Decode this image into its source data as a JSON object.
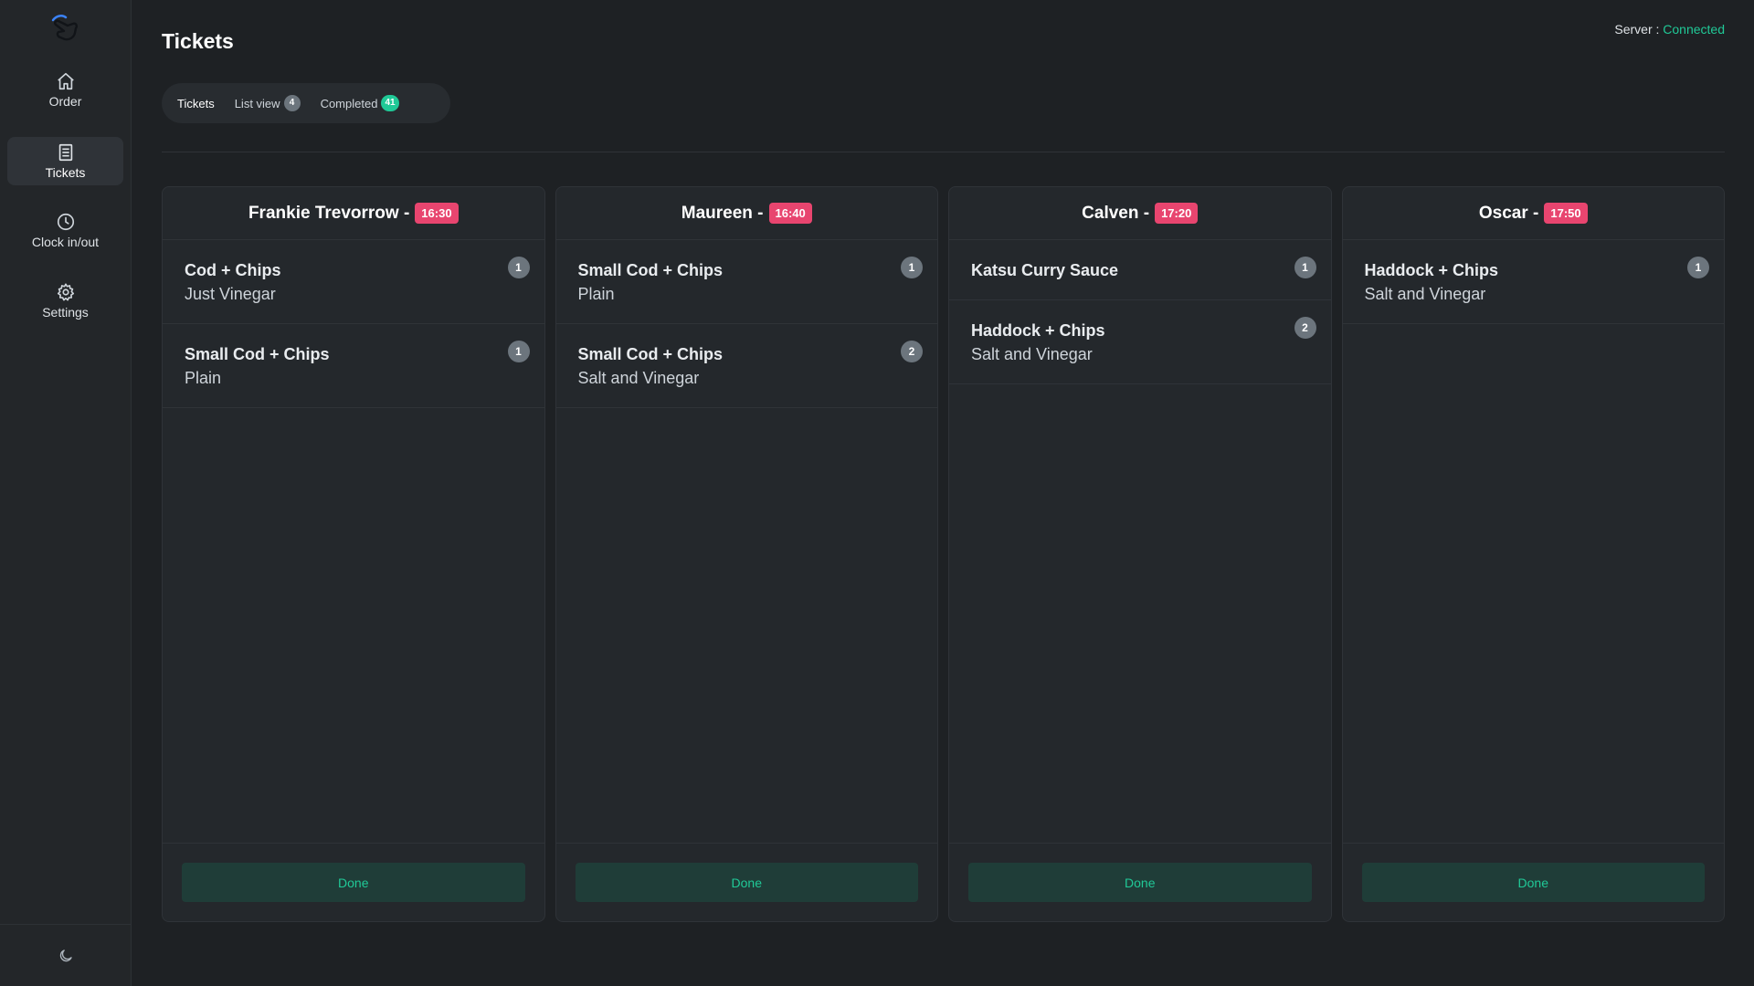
{
  "sidebar": {
    "logo_icon": "hand-pointer-logo",
    "items": [
      {
        "label": "Order",
        "icon": "home-icon",
        "active": false
      },
      {
        "label": "Tickets",
        "icon": "receipt-icon",
        "active": true
      },
      {
        "label": "Clock in/out",
        "icon": "clock-icon",
        "active": false
      },
      {
        "label": "Settings",
        "icon": "gear-icon",
        "active": false
      }
    ],
    "theme_toggle_icon": "moon-icon"
  },
  "header": {
    "title": "Tickets",
    "server_label": "Server :",
    "server_status": "Connected"
  },
  "tabs": [
    {
      "label": "Tickets",
      "active": true
    },
    {
      "label": "List view",
      "badge": "4",
      "badge_color": "#6c757d"
    },
    {
      "label": "Completed",
      "badge": "41",
      "badge_color": "#20c997"
    }
  ],
  "colors": {
    "accent": "#20c997",
    "time_badge": "#e8456f",
    "qty_badge": "#6c757d",
    "background": "#1e2124"
  },
  "tickets": [
    {
      "customer": "Frankie Trevorrow",
      "separator": "-",
      "time": "16:30",
      "items": [
        {
          "name": "Cod + Chips",
          "note": "Just Vinegar",
          "qty": "1"
        },
        {
          "name": "Small Cod + Chips",
          "note": "Plain",
          "qty": "1"
        }
      ],
      "done_label": "Done"
    },
    {
      "customer": "Maureen",
      "separator": "-",
      "time": "16:40",
      "items": [
        {
          "name": "Small Cod + Chips",
          "note": "Plain",
          "qty": "1"
        },
        {
          "name": "Small Cod + Chips",
          "note": "Salt and Vinegar",
          "qty": "2"
        }
      ],
      "done_label": "Done"
    },
    {
      "customer": "Calven",
      "separator": "-",
      "time": "17:20",
      "items": [
        {
          "name": "Katsu Curry Sauce",
          "note": "",
          "qty": "1"
        },
        {
          "name": "Haddock + Chips",
          "note": "Salt and Vinegar",
          "qty": "2"
        }
      ],
      "done_label": "Done"
    },
    {
      "customer": "Oscar",
      "separator": "-",
      "time": "17:50",
      "items": [
        {
          "name": "Haddock + Chips",
          "note": "Salt and Vinegar",
          "qty": "1"
        }
      ],
      "done_label": "Done"
    }
  ]
}
